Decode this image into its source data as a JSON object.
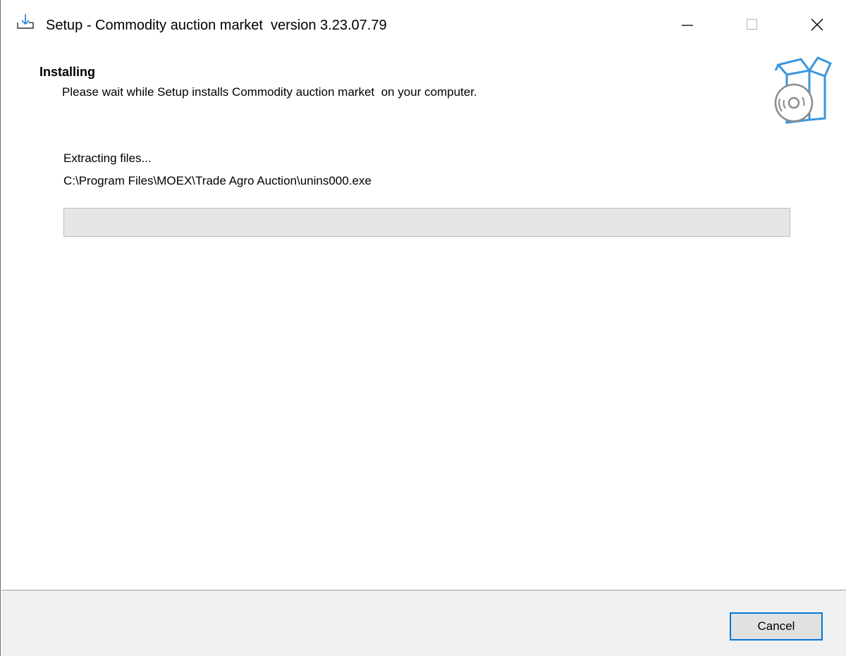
{
  "window": {
    "title": "Setup - Commodity auction market  version 3.23.07.79",
    "title_icon": "setup-install-icon",
    "controls": {
      "minimize_icon": "minimize-icon",
      "maximize_icon": "maximize-icon",
      "close_icon": "close-icon"
    }
  },
  "header": {
    "heading": "Installing",
    "subheading": "Please wait while Setup installs Commodity auction market  on your computer.",
    "image_icon": "software-box-disc-icon"
  },
  "body": {
    "status_label": "Extracting files...",
    "file_path": "C:\\Program Files\\MOEX\\Trade Agro Auction\\unins000.exe",
    "progress_fraction": 0.0
  },
  "footer": {
    "cancel_label": "Cancel"
  },
  "colors": {
    "accent": "#0078d7",
    "icon_blue": "#3a96dd",
    "progress_track": "#e6e6e6",
    "footer_bg": "#f0f0f0"
  }
}
